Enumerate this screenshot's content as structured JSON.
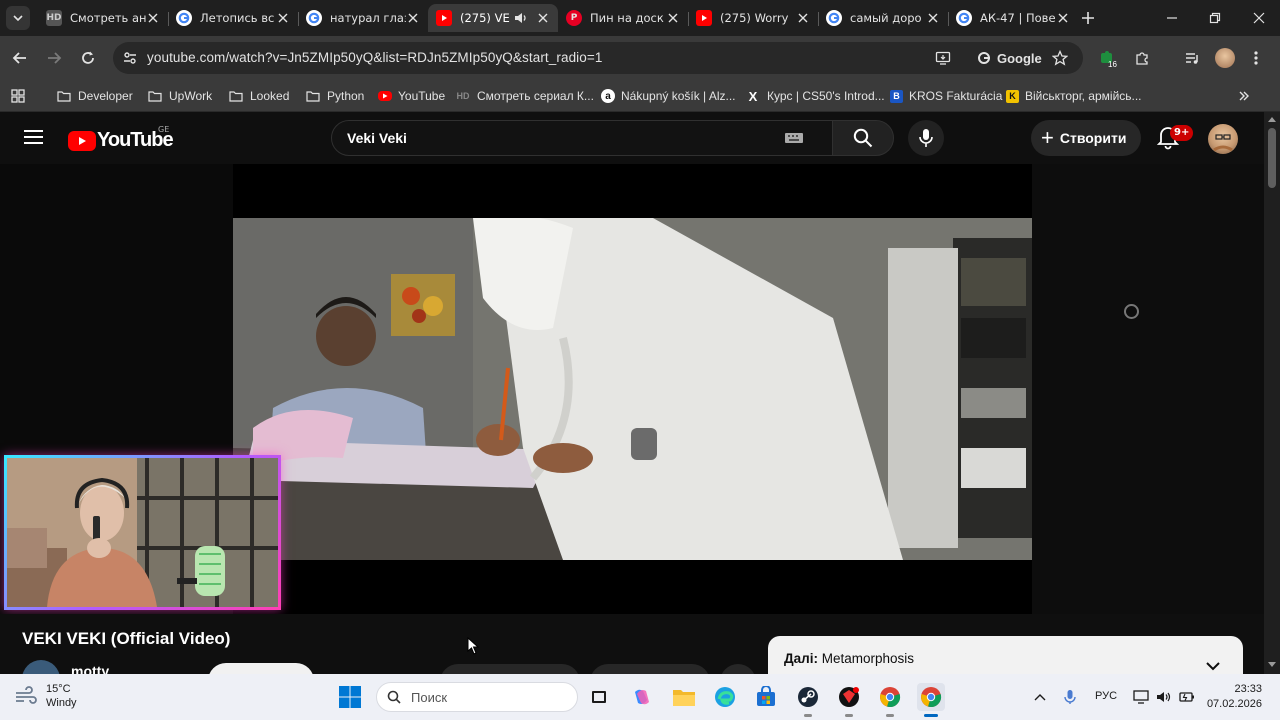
{
  "browser": {
    "tabs": [
      {
        "title": "Смотреть ан",
        "favicon": "hd-icon",
        "active": false
      },
      {
        "title": "Летопись вс",
        "favicon": "google-icon",
        "active": false
      },
      {
        "title": "натурал глаз",
        "favicon": "google-icon",
        "active": false
      },
      {
        "title": "(275) VE",
        "favicon": "youtube-icon",
        "active": true,
        "audio": true
      },
      {
        "title": "Пин на доск",
        "favicon": "pinterest-icon",
        "active": false
      },
      {
        "title": "(275) Worry",
        "favicon": "youtube-icon",
        "active": false
      },
      {
        "title": "самый доро",
        "favicon": "google-icon",
        "active": false
      },
      {
        "title": "АК-47 | Пове",
        "favicon": "google-icon",
        "active": false
      }
    ],
    "url": "youtube.com/watch?v=Jn5ZMIp50yQ&list=RDJn5ZMIp50yQ&start_radio=1",
    "search_engine_chip": "Google",
    "extension_badge": "16",
    "bookmarks": [
      {
        "label": "Developer",
        "icon": "folder-icon"
      },
      {
        "label": "UpWork",
        "icon": "folder-icon"
      },
      {
        "label": "Looked",
        "icon": "folder-icon"
      },
      {
        "label": "Python",
        "icon": "folder-icon"
      },
      {
        "label": "YouTube",
        "icon": "youtube-icon"
      },
      {
        "label": "Смотреть сериал К...",
        "icon": "hd-icon"
      },
      {
        "label": "Nákupný košík | Alz...",
        "icon": "alza-icon"
      },
      {
        "label": "Курс | CS50's Introd...",
        "icon": "x-icon"
      },
      {
        "label": "KROS Fakturácia",
        "icon": "kros-icon"
      },
      {
        "label": "Військторг, армійсь...",
        "icon": "k-icon"
      }
    ]
  },
  "youtube": {
    "logo_text": "YouTube",
    "region": "GE",
    "search_value": "Veki Veki",
    "create_label": "Створити",
    "notifications_badge": "9+",
    "video_title": "VEKI VEKI (Official Video)",
    "channel_name": "motty",
    "next_label": "Далі:",
    "next_title": "Metamorphosis"
  },
  "taskbar": {
    "weather_temp": "15°C",
    "weather_desc": "Windy",
    "search_placeholder": "Поиск",
    "lang": "РУС",
    "time": "23:33",
    "date": "07.02.2026",
    "apps": [
      "task-view-icon",
      "copilot-icon",
      "file-explorer-icon",
      "edge-icon",
      "store-icon",
      "steam-icon",
      "app-icon",
      "chrome-icon",
      "chrome-icon"
    ]
  },
  "colors": {
    "youtube_red": "#ff0000",
    "browser_dark": "#1f1f1f",
    "toolbar": "#3a3a3a",
    "page_bg": "#0f0f0f",
    "taskbar_bg": "#eef0f6",
    "webcam_border_start": "#38e8ff",
    "webcam_border_end": "#ff3fb4"
  }
}
